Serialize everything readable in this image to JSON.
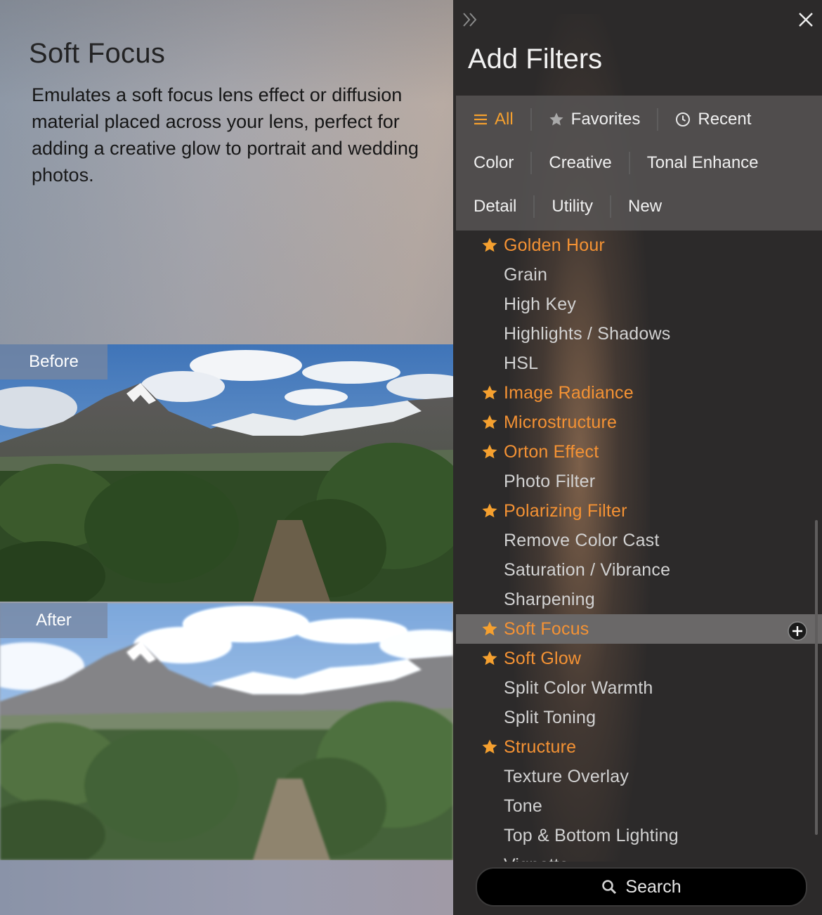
{
  "description": {
    "title": "Soft Focus",
    "text": "Emulates a soft focus lens effect or diffusion material placed across your lens, perfect for adding a creative glow to portrait and wedding photos."
  },
  "preview": {
    "before_label": "Before",
    "after_label": "After"
  },
  "panel": {
    "title": "Add Filters",
    "categories_row1": [
      {
        "label": "All",
        "icon": "menu-icon",
        "active": true
      },
      {
        "label": "Favorites",
        "icon": "star-icon"
      },
      {
        "label": "Recent",
        "icon": "clock-icon"
      }
    ],
    "categories_row2": [
      "Color",
      "Creative",
      "Tonal Enhance"
    ],
    "categories_row3": [
      "Detail",
      "Utility",
      "New"
    ],
    "filters": [
      {
        "label": "Golden Hour",
        "favorite": true
      },
      {
        "label": "Grain",
        "favorite": false
      },
      {
        "label": "High Key",
        "favorite": false
      },
      {
        "label": "Highlights / Shadows",
        "favorite": false
      },
      {
        "label": "HSL",
        "favorite": false
      },
      {
        "label": "Image Radiance",
        "favorite": true
      },
      {
        "label": "Microstructure",
        "favorite": true
      },
      {
        "label": "Orton Effect",
        "favorite": true
      },
      {
        "label": "Photo Filter",
        "favorite": false
      },
      {
        "label": "Polarizing Filter",
        "favorite": true
      },
      {
        "label": "Remove Color Cast",
        "favorite": false
      },
      {
        "label": "Saturation / Vibrance",
        "favorite": false
      },
      {
        "label": "Sharpening",
        "favorite": false
      },
      {
        "label": "Soft Focus",
        "favorite": true,
        "selected": true
      },
      {
        "label": "Soft Glow",
        "favorite": true
      },
      {
        "label": "Split Color Warmth",
        "favorite": false
      },
      {
        "label": "Split Toning",
        "favorite": false
      },
      {
        "label": "Structure",
        "favorite": true
      },
      {
        "label": "Texture Overlay",
        "favorite": false
      },
      {
        "label": "Tone",
        "favorite": false
      },
      {
        "label": "Top & Bottom Lighting",
        "favorite": false
      },
      {
        "label": "Vignette",
        "favorite": false
      }
    ],
    "search_label": "Search"
  },
  "colors": {
    "accent": "#f5a02f",
    "favorite_text": "#f49234",
    "panel_bg": "#2c2a2a",
    "selected_row": "#6a6868"
  }
}
